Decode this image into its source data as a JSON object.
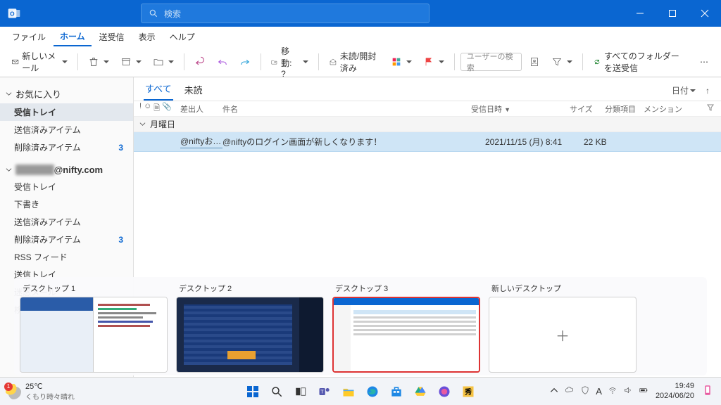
{
  "titlebar": {
    "search_placeholder": "検索"
  },
  "menu": {
    "file": "ファイル",
    "home": "ホーム",
    "sendrecv": "送受信",
    "view": "表示",
    "help": "ヘルプ"
  },
  "ribbon": {
    "new_mail": "新しいメール",
    "move": "移動: ?",
    "unread_read": "未読/開封済み",
    "user_search_ph": "ユーザーの検索",
    "sendrecv_all": "すべてのフォルダーを送受信"
  },
  "sidebar": {
    "favorites": "お気に入り",
    "items_fav": [
      {
        "label": "受信トレイ",
        "selected": true
      },
      {
        "label": "送信済みアイテム"
      },
      {
        "label": "削除済みアイテム",
        "count": "3"
      }
    ],
    "account_suffix": "@nifty.com",
    "items_acct": [
      {
        "label": "受信トレイ"
      },
      {
        "label": "下書き"
      },
      {
        "label": "送信済みアイテム"
      },
      {
        "label": "削除済みアイテム",
        "count": "3"
      },
      {
        "label": "RSS フィード"
      },
      {
        "label": "送信トレイ"
      },
      {
        "label": "迷惑メール"
      },
      {
        "label": "検索フォルダー"
      }
    ]
  },
  "list": {
    "tab_all": "すべて",
    "tab_unread": "未読",
    "sort_label": "日付",
    "col_from": "差出人",
    "col_subject": "件名",
    "col_date": "受信日時",
    "col_size": "サイズ",
    "col_cat": "分類項目",
    "col_mention": "メンション",
    "group": "月曜日",
    "row": {
      "from": "@niftyお楽...",
      "subject": "@niftyのログイン画面が新しくなります！",
      "date": "2021/11/15 (月) 8:41",
      "size": "22 KB"
    }
  },
  "desks": {
    "d1": "デスクトップ 1",
    "d2": "デスクトップ 2",
    "d3": "デスクトップ 3",
    "new": "新しいデスクトップ"
  },
  "taskbar": {
    "temp": "25℃",
    "weather_desc": "くもり時々晴れ",
    "badge": "1",
    "time": "19:49",
    "date": "2024/06/20",
    "ime": "A"
  }
}
